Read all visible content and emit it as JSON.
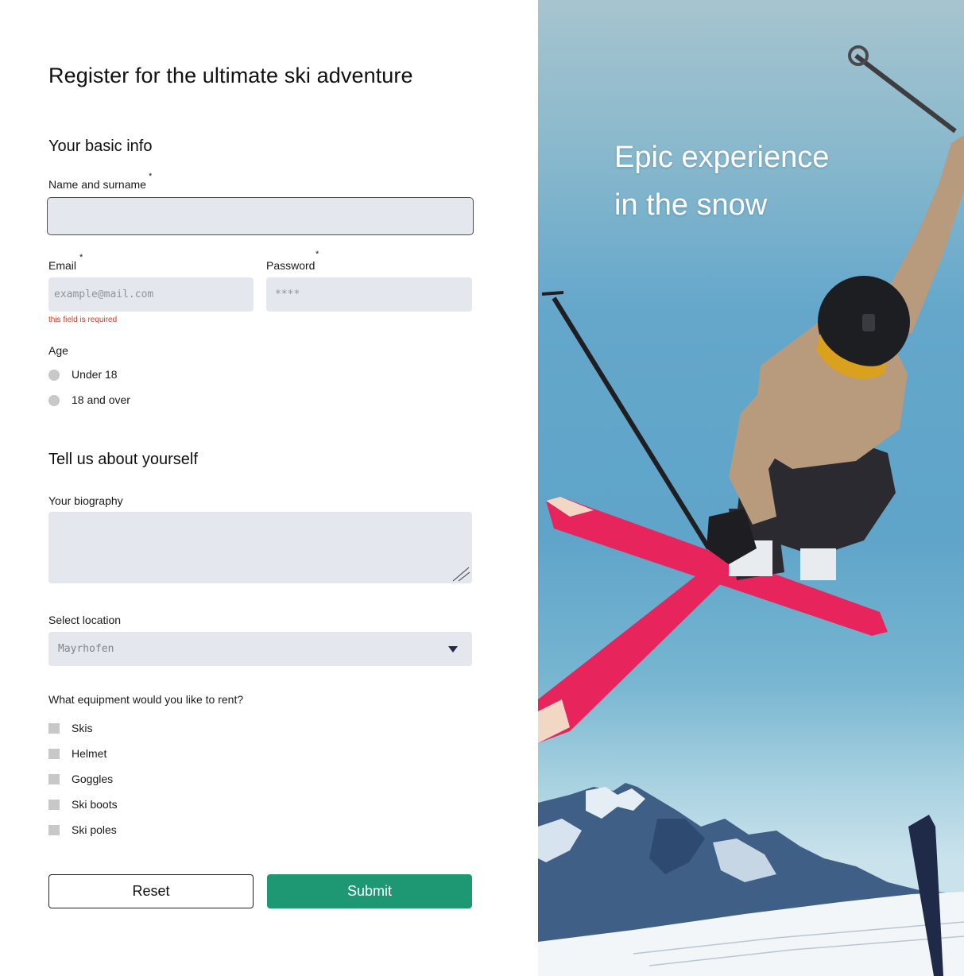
{
  "form": {
    "title": "Register for the ultimate ski adventure",
    "basic_info": {
      "heading": "Your basic info",
      "name_label": "Name and surname",
      "name_value": "",
      "required_marker": "*",
      "email_label": "Email",
      "email_placeholder": "example@mail.com",
      "email_error": "this field is required",
      "password_label": "Password",
      "password_placeholder": "****"
    },
    "age": {
      "label": "Age",
      "options": [
        "Under 18",
        "18 and over"
      ]
    },
    "about": {
      "heading": "Tell us about yourself",
      "bio_label": "Your biography",
      "bio_value": "",
      "location_label": "Select location",
      "location_value": "Mayrhofen"
    },
    "equipment": {
      "label": "What equipment would you like to rent?",
      "options": [
        "Skis",
        "Helmet",
        "Goggles",
        "Ski boots",
        "Ski poles"
      ]
    },
    "buttons": {
      "reset": "Reset",
      "submit": "Submit"
    }
  },
  "hero": {
    "headline_line1": "Epic experience",
    "headline_line2": "in the snow",
    "image": "skier-jumping-photo"
  },
  "colors": {
    "accent": "#1e9872",
    "error": "#cf3a2a",
    "field_background": "#e4e7ee",
    "control_gray": "#c8c8c8"
  }
}
